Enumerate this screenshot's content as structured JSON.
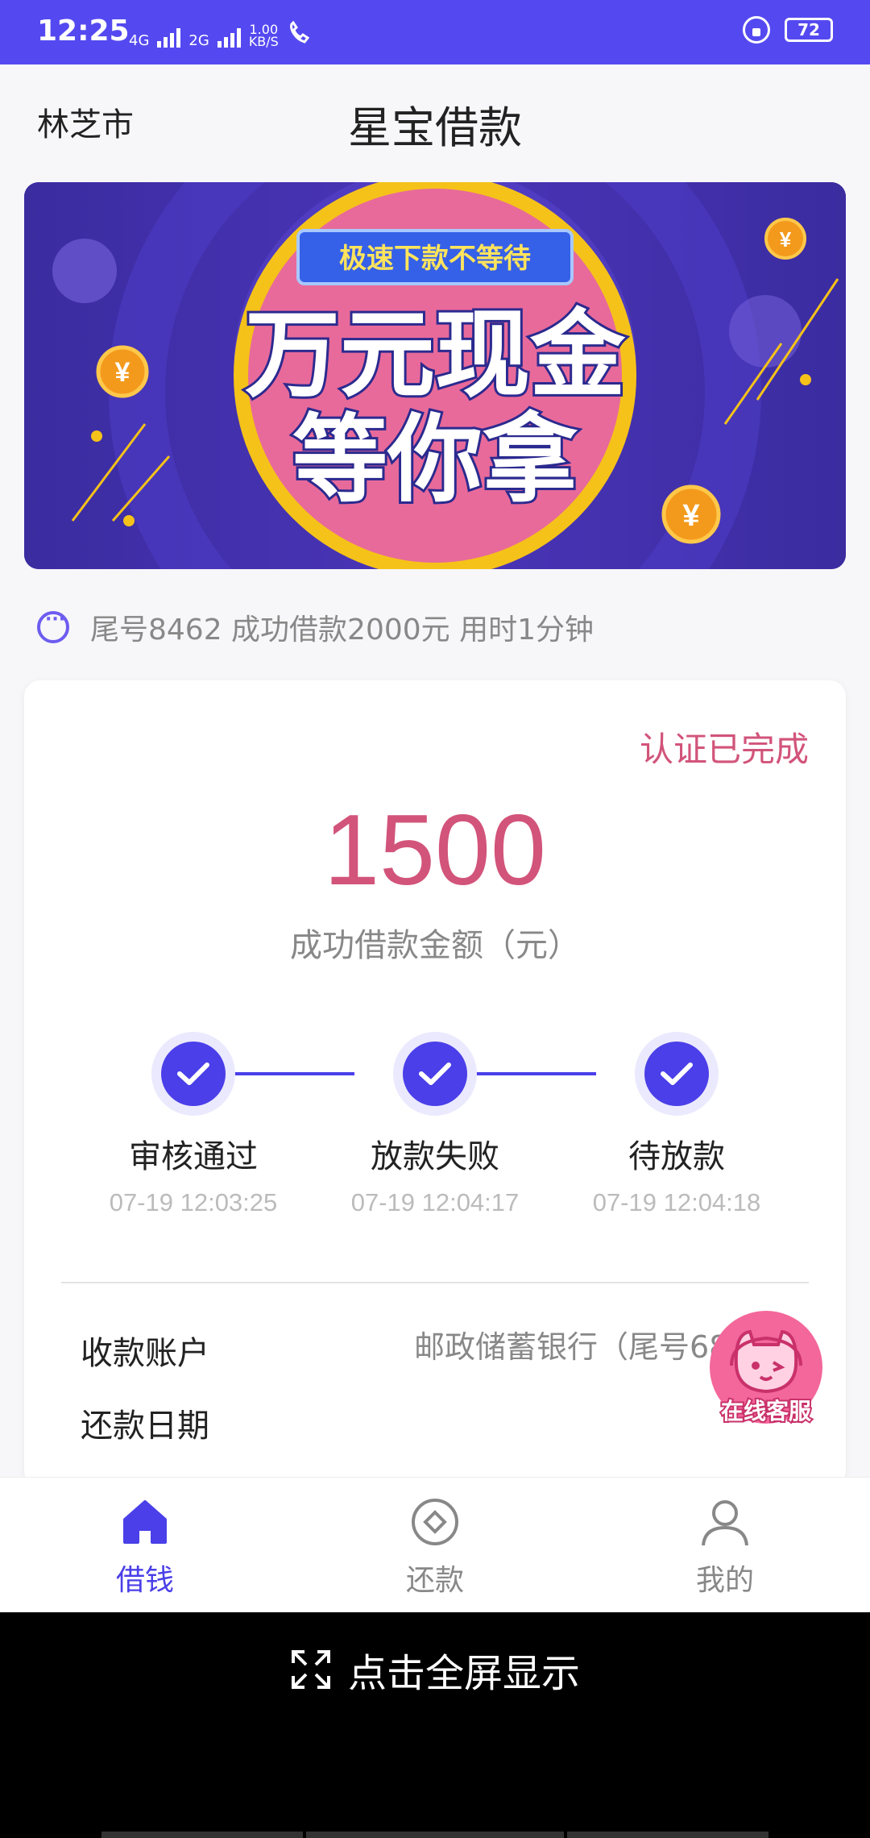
{
  "status_bar": {
    "time": "12:25",
    "network_1": "4G",
    "network_2": "2G",
    "speed_value": "1.00",
    "speed_unit": "KB/S",
    "battery": "72"
  },
  "header": {
    "city": "林芝市",
    "title": "星宝借款"
  },
  "banner": {
    "tagline": "极速下款不等待",
    "line1": "万元现金",
    "line2": "等你拿",
    "currency_symbol": "¥"
  },
  "notice": {
    "text": "尾号8462 成功借款2000元 用时1分钟"
  },
  "card": {
    "verified_label": "认证已完成",
    "amount": "1500",
    "amount_label": "成功借款金额（元）",
    "steps": [
      {
        "label": "审核通过",
        "time": "07-19 12:03:25"
      },
      {
        "label": "放款失败",
        "time": "07-19 12:04:17"
      },
      {
        "label": "待放款",
        "time": "07-19 12:04:18"
      }
    ],
    "account_label": "收款账户",
    "account_value": "邮政储蓄银行（尾号68",
    "repay_date_label": "还款日期"
  },
  "customer_service": {
    "label": "在线客服"
  },
  "tabs": [
    {
      "label": "借钱",
      "icon": "home-icon",
      "active": true
    },
    {
      "label": "还款",
      "icon": "repay-icon",
      "active": false
    },
    {
      "label": "我的",
      "icon": "user-icon",
      "active": false
    }
  ],
  "fullscreen": {
    "label": "点击全屏显示"
  },
  "colors": {
    "brand": "#5449f0",
    "accent": "#4a3fe8",
    "amount": "#d2547a",
    "muted": "#888888"
  }
}
